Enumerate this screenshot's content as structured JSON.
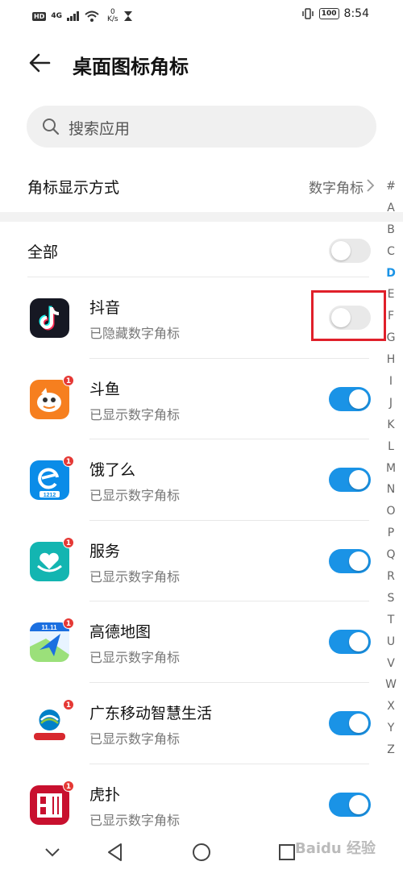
{
  "status_bar": {
    "hd": "HD",
    "signal": "4G",
    "speed_value": "0",
    "speed_unit": "K/s",
    "battery": "100",
    "time": "8:54"
  },
  "header": {
    "title": "桌面图标角标"
  },
  "search": {
    "placeholder": "搜索应用"
  },
  "badge_mode": {
    "label": "角标显示方式",
    "value": "数字角标"
  },
  "all_toggle": {
    "label": "全部",
    "on": false
  },
  "apps": [
    {
      "name": "抖音",
      "subtitle": "已隐藏数字角标",
      "on": false,
      "icon": "douyin-icon",
      "badge": ""
    },
    {
      "name": "斗鱼",
      "subtitle": "已显示数字角标",
      "on": true,
      "icon": "douyu-icon",
      "badge": "1"
    },
    {
      "name": "饿了么",
      "subtitle": "已显示数字角标",
      "on": true,
      "icon": "eleme-icon",
      "badge": "1"
    },
    {
      "name": "服务",
      "subtitle": "已显示数字角标",
      "on": true,
      "icon": "service-icon",
      "badge": "1"
    },
    {
      "name": "高德地图",
      "subtitle": "已显示数字角标",
      "on": true,
      "icon": "amap-icon",
      "badge": "1"
    },
    {
      "name": "广东移动智慧生活",
      "subtitle": "已显示数字角标",
      "on": true,
      "icon": "china-mobile-icon",
      "badge": "1"
    },
    {
      "name": "虎扑",
      "subtitle": "已显示数字角标",
      "on": true,
      "icon": "hupu-icon",
      "badge": "1"
    }
  ],
  "index_letters": [
    "#",
    "A",
    "B",
    "C",
    "D",
    "E",
    "F",
    "G",
    "H",
    "I",
    "J",
    "K",
    "L",
    "M",
    "N",
    "O",
    "P",
    "Q",
    "R",
    "S",
    "T",
    "U",
    "V",
    "W",
    "X",
    "Y",
    "Z"
  ],
  "index_active": "D",
  "watermark": "Baidu 经验",
  "colors": {
    "accent": "#1a93e6",
    "highlight": "#e0202a"
  }
}
